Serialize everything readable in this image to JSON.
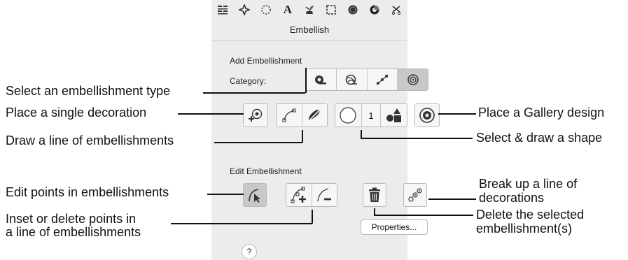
{
  "toolbar": {
    "icons": [
      "layers-icon",
      "sparkle-icon",
      "dotted-circle-icon",
      "text-A-icon",
      "plant-icon",
      "frame-icon",
      "stitch-circle-icon",
      "embellish-icon",
      "scissors-icon"
    ],
    "text_A": "A"
  },
  "panel": {
    "title": "Embellish",
    "add_section": "Add Embellishment",
    "category_label": "Category:",
    "count_value": "1",
    "edit_section": "Edit Embellishment",
    "properties_button": "Properties...",
    "help_button": "?"
  },
  "callouts": {
    "select_type": "Select an embellishment type",
    "place_single": "Place a single decoration",
    "draw_line": "Draw a line of embellishments",
    "place_gallery": "Place a Gallery design",
    "select_shape": "Select & draw a shape",
    "edit_points": "Edit points in embellishments",
    "inset_delete_1": "Inset or delete points in",
    "inset_delete_2": "a line of embellishments",
    "break_up_1": "Break up a line of",
    "break_up_2": "decorations",
    "delete_sel_1": "Delete the selected",
    "delete_sel_2": "embellishment(s)"
  },
  "colors": {
    "panel_bg": "#ececec",
    "selected_bg": "#c8c8c8",
    "line": "#111111"
  }
}
